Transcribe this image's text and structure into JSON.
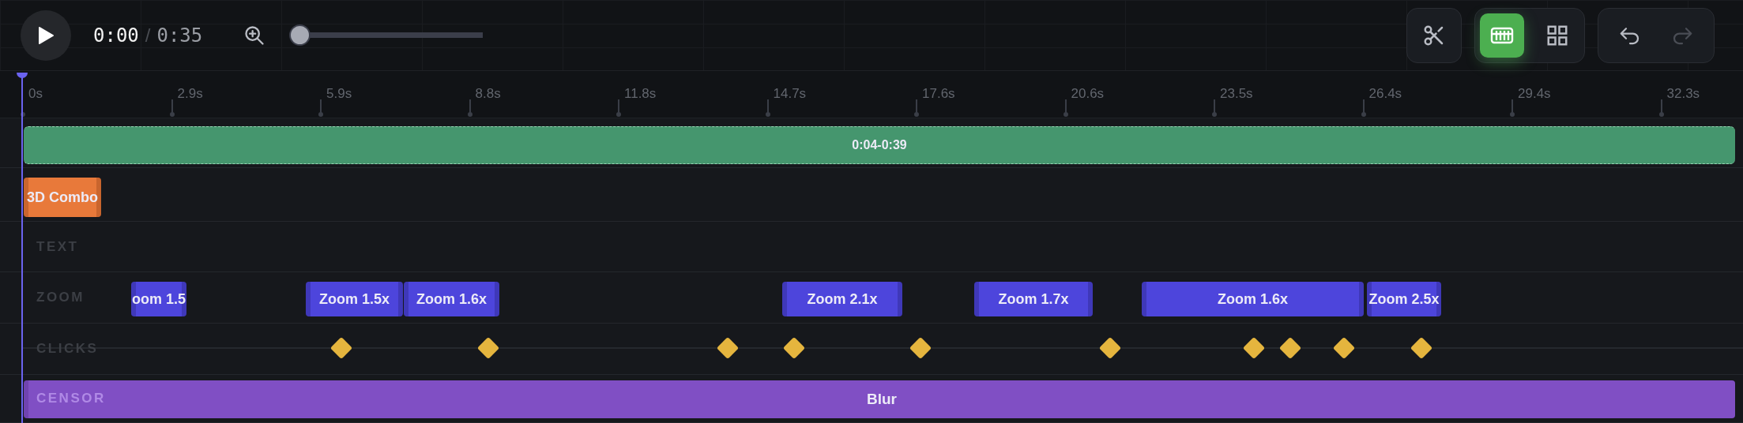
{
  "player": {
    "current_time": "0:00",
    "separator": "/",
    "duration": "0:35"
  },
  "zoom_slider": {
    "level": 0
  },
  "toolbar": {
    "split": {
      "disabled": false
    },
    "views": [
      {
        "kind": "timeline",
        "selected": true
      },
      {
        "kind": "grid",
        "selected": false
      }
    ],
    "history": [
      {
        "kind": "undo",
        "disabled": false
      },
      {
        "kind": "redo",
        "disabled": true
      }
    ]
  },
  "ruler": {
    "ticks": [
      "0s",
      "2.9s",
      "5.9s",
      "8.8s",
      "11.8s",
      "14.7s",
      "17.6s",
      "20.6s",
      "23.5s",
      "26.4s",
      "29.4s",
      "32.3s"
    ]
  },
  "tracks": [
    {
      "kind": "range",
      "clips": [
        {
          "label": "0:04-0:39"
        }
      ]
    },
    {
      "kind": "effect",
      "clips": [
        {
          "label": "3D Combo"
        }
      ]
    },
    {
      "kind": "text",
      "label": "TEXT"
    },
    {
      "kind": "zoom",
      "label": "ZOOM",
      "clips": [
        {
          "label": "oom 1.5"
        },
        {
          "label": "Zoom 1.5x"
        },
        {
          "label": "Zoom 1.6x"
        },
        {
          "label": "Zoom 2.1x"
        },
        {
          "label": "Zoom 1.7x"
        },
        {
          "label": "Zoom 1.6x"
        },
        {
          "label": "Zoom 2.5x"
        }
      ]
    },
    {
      "kind": "clicks",
      "label": "CLICKS"
    },
    {
      "kind": "censor",
      "label": "CENSOR",
      "clips": [
        {
          "label": "Blur"
        }
      ]
    }
  ]
}
